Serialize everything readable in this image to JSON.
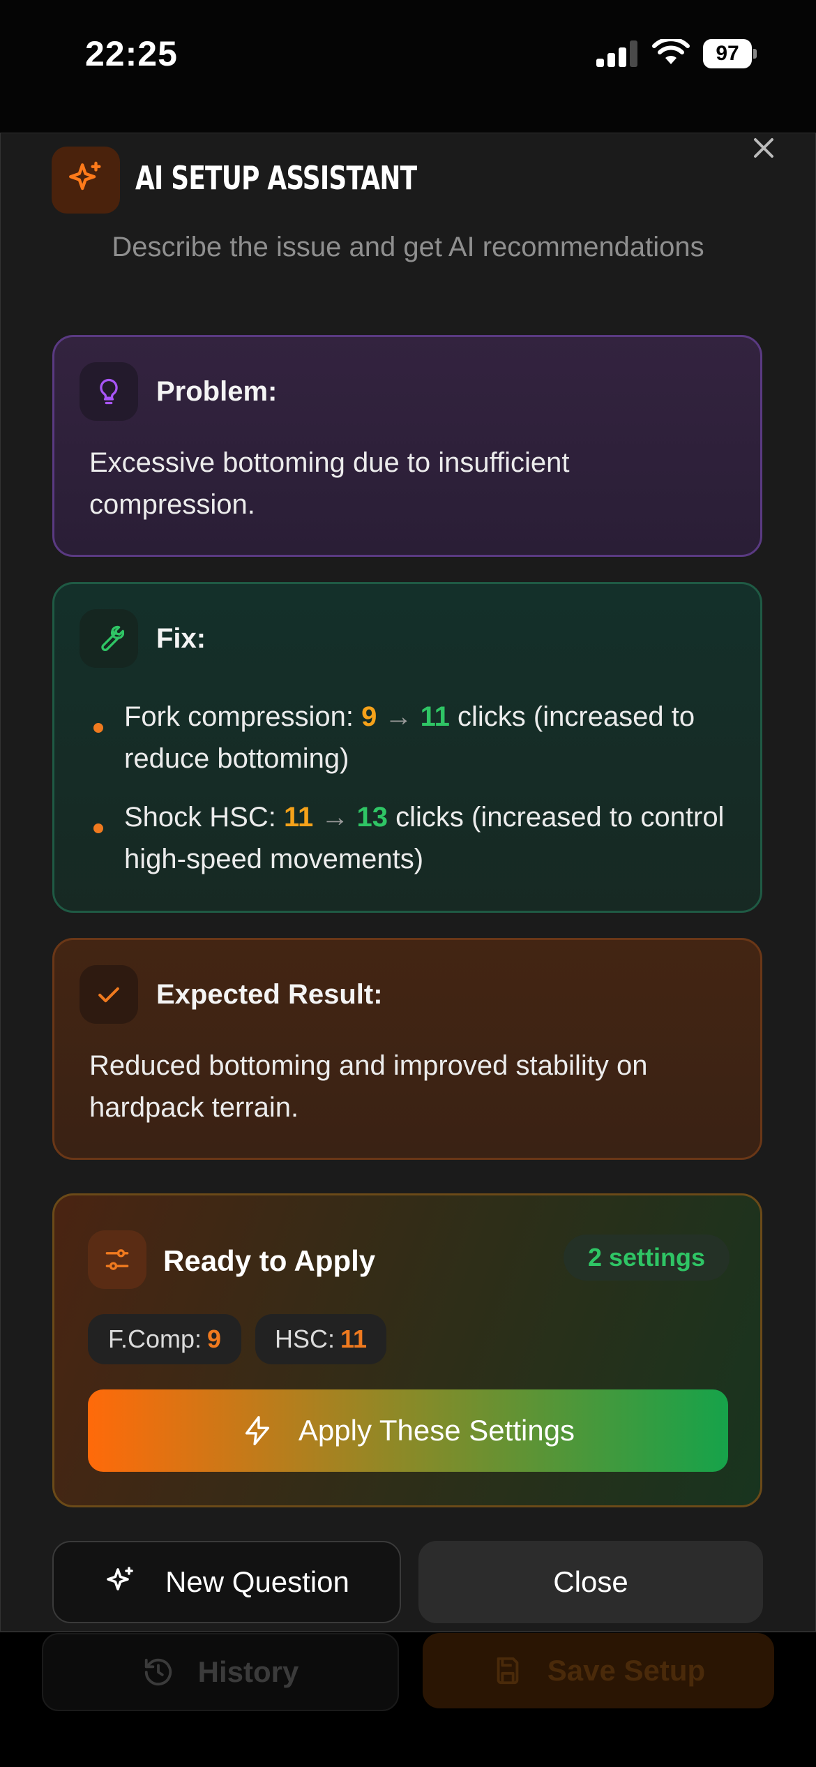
{
  "status_bar": {
    "time": "22:25",
    "battery": "97"
  },
  "background": {
    "history_label": "History",
    "save_label": "Save Setup"
  },
  "header": {
    "title": "AI SETUP ASSISTANT",
    "subtitle": "Describe the issue and get AI recommendations"
  },
  "problem": {
    "label": "Problem:",
    "text": "Excessive bottoming due to insufficient compression."
  },
  "fix": {
    "label": "Fix:",
    "items": [
      {
        "name": "Fork compression:",
        "old": "9",
        "arrow": "→",
        "new": "11",
        "rest": "clicks (increased to reduce bottoming)"
      },
      {
        "name": "Shock HSC:",
        "old": "11",
        "arrow": "→",
        "new": "13",
        "rest": "clicks (increased to control high-speed movements)"
      }
    ]
  },
  "result": {
    "label": "Expected Result:",
    "text": "Reduced bottoming and improved stability on hardpack terrain."
  },
  "apply": {
    "title": "Ready to Apply",
    "badge": "2 settings",
    "chips": [
      {
        "label": "F.Comp:",
        "value": "9"
      },
      {
        "label": "HSC:",
        "value": "11"
      }
    ],
    "button_label": "Apply These Settings"
  },
  "footer": {
    "new_question_label": "New Question",
    "close_label": "Close"
  },
  "colors": {
    "accent_orange": "#f07a1f",
    "accent_green": "#2fc565",
    "accent_purple": "#a855f7"
  },
  "icons": [
    "sparkle-icon",
    "close-icon",
    "lightbulb-icon",
    "wrench-icon",
    "check-icon",
    "sliders-icon",
    "lightning-icon",
    "history-icon",
    "save-icon"
  ]
}
